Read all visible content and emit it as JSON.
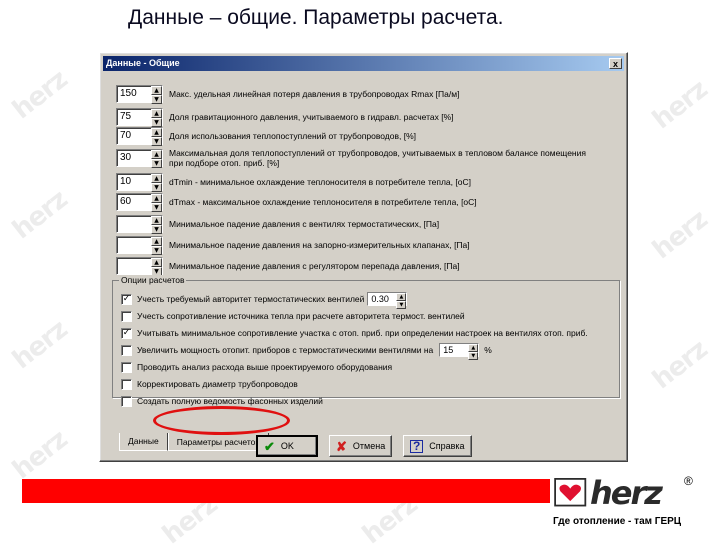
{
  "slide_title": "Данные – общие. Параметры расчета.",
  "dialog": {
    "title": "Данные - Общие",
    "close_label": "x"
  },
  "params": [
    {
      "value": "150",
      "label": "Макс. удельная линейная потеря давления в трубопроводах Rmax [Па/м]"
    },
    {
      "value": "75",
      "label": "Доля гравитационного давления, учитываемого в гидравл. расчетах [%]"
    },
    {
      "value": "70",
      "label": "Доля использования теплопоступлений от трубопроводов, [%]"
    },
    {
      "value": "30",
      "label": "Максимальная доля теплопоступлений от трубопроводов, учитываемых в тепловом балансе помещения при подборе отоп. приб. [%]"
    },
    {
      "value": "10",
      "label": "dTmin - минимальное охлаждение теплоносителя в потребителе тепла, [oC]"
    },
    {
      "value": "60",
      "label": "dTmax - максимальное охлаждение теплоносителя в потребителе тепла, [oC]"
    },
    {
      "value": "",
      "label": "Минимальное падение давления с вентилях термостатических, [Па]"
    },
    {
      "value": "",
      "label": "Минимальное падение давления на запорно-измерительных клапанах, [Па]"
    },
    {
      "value": "",
      "label": "Минимальное падение давления с регулятором перепада давления, [Па]"
    }
  ],
  "options": {
    "title": "Опции расчетов",
    "items": [
      {
        "checked": true,
        "label": "Учесть требуемый авторитет термостатических вентилей",
        "spin": "0.30"
      },
      {
        "checked": false,
        "label": "Учесть сопротивление источника тепла при расчете авторитета термост. вентилей"
      },
      {
        "checked": true,
        "label": "Учитывать минимальное сопротивление участка с отоп. приб. при определении настроек на вентилях отоп. приб."
      },
      {
        "checked": false,
        "label": "Увеличить мощность отопит. приборов с термостатическими вентилями на",
        "spin": "15",
        "suffix": "%"
      },
      {
        "checked": false,
        "label": "Проводить анализ расхода выше проектируемого оборудования"
      },
      {
        "checked": false,
        "label": "Корректировать диаметр трубопроводов"
      },
      {
        "checked": false,
        "label": "Создать полную ведомость фасонных изделий"
      }
    ]
  },
  "tabs": [
    "Данные",
    "Параметры расчетов"
  ],
  "buttons": {
    "ok": "OK",
    "cancel": "Отмена",
    "help": "Справка"
  },
  "icons": {
    "ok": "checkmark-icon",
    "cancel": "cross-icon",
    "help": "question-icon"
  },
  "watermark": "herz",
  "footer": {
    "brand": "herz",
    "registered": "®",
    "slogan": "Где отопление - там ГЕРЦ",
    "bar_color": "#ff0000"
  }
}
